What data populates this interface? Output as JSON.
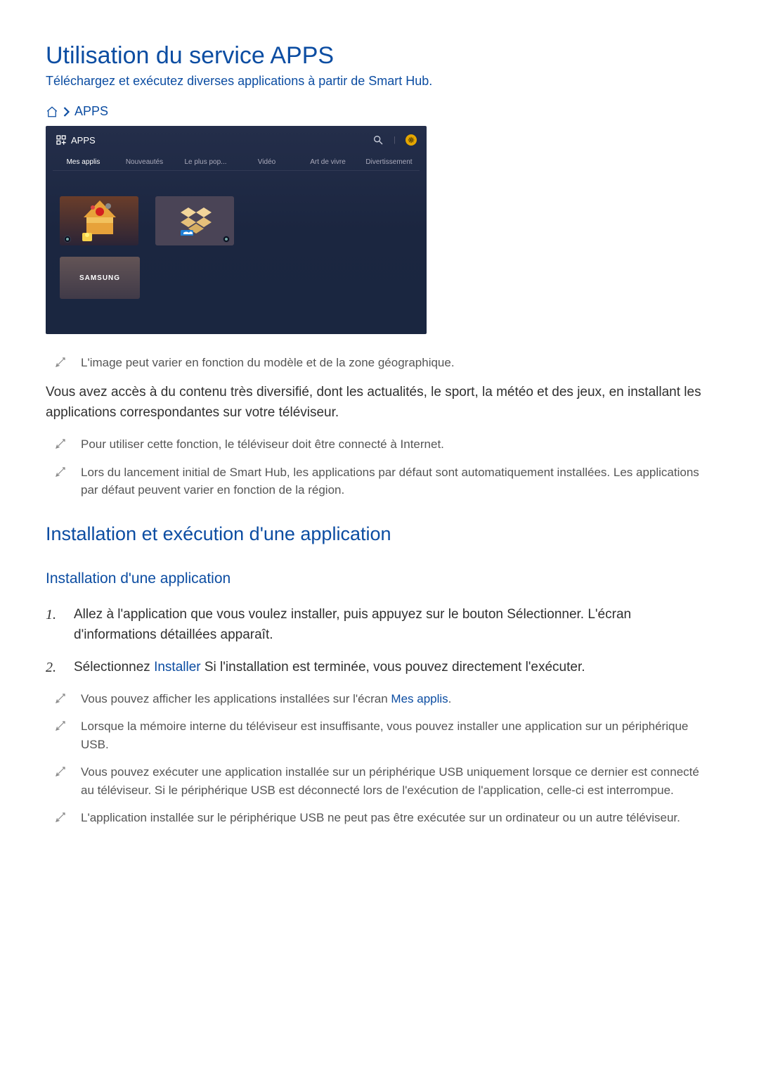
{
  "page": {
    "title": "Utilisation du service APPS",
    "subtitle": "Téléchargez et exécutez diverses applications à partir de Smart Hub."
  },
  "breadcrumb": {
    "apps": "APPS"
  },
  "apps_panel": {
    "header": "APPS",
    "tabs": [
      "Mes applis",
      "Nouveautés",
      "Le plus pop...",
      "Vidéo",
      "Art de vivre",
      "Divertissement"
    ],
    "samsung": "SAMSUNG"
  },
  "notes": {
    "n1": "L'image peut varier en fonction du modèle et de la zone géographique.",
    "n2": "Pour utiliser cette fonction, le téléviseur doit être connecté à Internet.",
    "n3": "Lors du lancement initial de Smart Hub, les applications par défaut sont automatiquement installées. Les applications par défaut peuvent varier en fonction de la région.",
    "n4_a": "Vous pouvez afficher les applications installées sur l'écran ",
    "n4_b": "Mes applis",
    "n4_c": ".",
    "n5": "Lorsque la mémoire interne du téléviseur est insuffisante, vous pouvez installer une application sur un périphérique USB.",
    "n6": "Vous pouvez exécuter une application installée sur un périphérique USB uniquement lorsque ce dernier est connecté au téléviseur. Si le périphérique USB est déconnecté lors de l'exécution de l'application, celle-ci est interrompue.",
    "n7": "L'application installée sur le périphérique USB ne peut pas être exécutée sur un ordinateur ou un autre téléviseur."
  },
  "body": {
    "p1": "Vous avez accès à du contenu très diversifié, dont les actualités, le sport, la météo et des jeux, en installant les applications correspondantes sur votre téléviseur."
  },
  "h2": "Installation et exécution d'une application",
  "h3": "Installation d'une application",
  "steps": {
    "s1_num": "1.",
    "s1": "Allez à l'application que vous voulez installer, puis appuyez sur le bouton Sélectionner. L'écran d'informations détaillées apparaît.",
    "s2_num": "2.",
    "s2_a": "Sélectionnez ",
    "s2_b": "Installer",
    "s2_c": " Si l'installation est terminée, vous pouvez directement l'exécuter."
  }
}
